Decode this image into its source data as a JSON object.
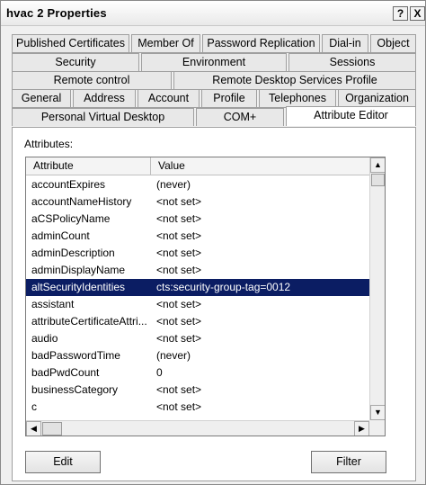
{
  "window": {
    "title": "hvac 2 Properties",
    "help_label": "?",
    "close_label": "X"
  },
  "tabs": {
    "row1": [
      "Published Certificates",
      "Member Of",
      "Password Replication",
      "Dial-in",
      "Object"
    ],
    "row2": [
      "Security",
      "Environment",
      "Sessions"
    ],
    "row3": [
      "Remote control",
      "Remote Desktop Services Profile"
    ],
    "row4": [
      "General",
      "Address",
      "Account",
      "Profile",
      "Telephones",
      "Organization"
    ],
    "row5": [
      "Personal Virtual Desktop",
      "COM+",
      "Attribute Editor"
    ],
    "active": "Attribute Editor"
  },
  "attribute_editor": {
    "section_label": "Attributes:",
    "columns": [
      "Attribute",
      "Value"
    ],
    "rows": [
      {
        "attribute": "accountExpires",
        "value": "(never)"
      },
      {
        "attribute": "accountNameHistory",
        "value": "<not set>"
      },
      {
        "attribute": "aCSPolicyName",
        "value": "<not set>"
      },
      {
        "attribute": "adminCount",
        "value": "<not set>"
      },
      {
        "attribute": "adminDescription",
        "value": "<not set>"
      },
      {
        "attribute": "adminDisplayName",
        "value": "<not set>"
      },
      {
        "attribute": "altSecurityIdentities",
        "value": "cts:security-group-tag=0012"
      },
      {
        "attribute": "assistant",
        "value": "<not set>"
      },
      {
        "attribute": "attributeCertificateAttri...",
        "value": "<not set>"
      },
      {
        "attribute": "audio",
        "value": "<not set>"
      },
      {
        "attribute": "badPasswordTime",
        "value": "(never)"
      },
      {
        "attribute": "badPwdCount",
        "value": "0"
      },
      {
        "attribute": "businessCategory",
        "value": "<not set>"
      },
      {
        "attribute": "c",
        "value": "<not set>"
      }
    ],
    "selected_row": "altSecurityIdentities",
    "buttons": {
      "edit": "Edit",
      "filter": "Filter"
    }
  },
  "colors": {
    "selection": "#0b1d63",
    "selection_text": "#ffffff"
  }
}
